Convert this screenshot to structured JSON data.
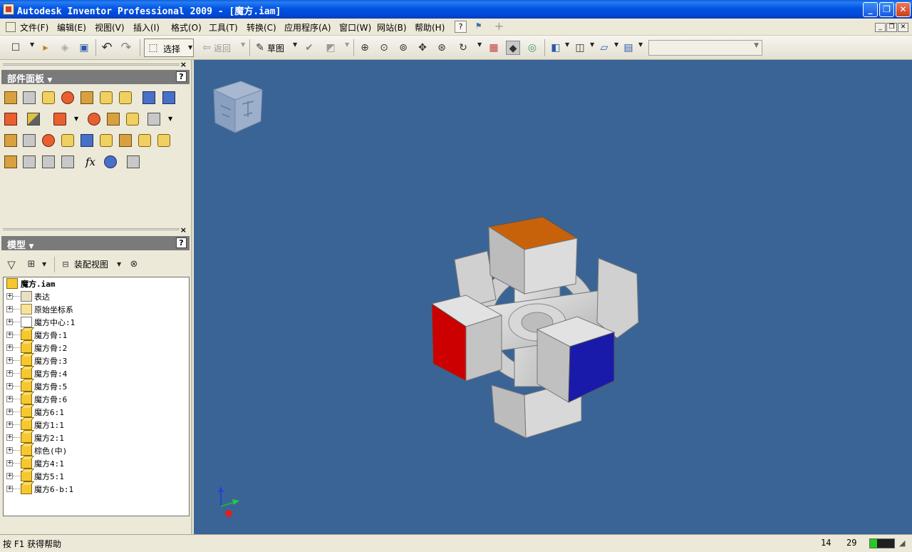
{
  "window": {
    "title": "Autodesk Inventor Professional 2009 - [魔方.iam]",
    "minimize": "_",
    "maximize": "❐",
    "close": "✕"
  },
  "menu": {
    "items": [
      "文件(F)",
      "编辑(E)",
      "视图(V)",
      "插入(I)",
      "格式(O)",
      "工具(T)",
      "转换(C)",
      "应用程序(A)",
      "窗口(W)",
      "网站(B)",
      "帮助(H)"
    ],
    "mdi_min": "_",
    "mdi_restore": "❐",
    "mdi_close": "✕"
  },
  "toolbar": {
    "select_label": "选择",
    "back_label": "返回",
    "sketch_label": "草图",
    "combo_value": ""
  },
  "panel": {
    "title": "部件面板",
    "help": "?",
    "close": "×"
  },
  "model": {
    "title": "模型",
    "help": "?",
    "close": "×",
    "view_label": "装配视图",
    "root": "魔方.iam",
    "items": [
      "表达",
      "原始坐标系",
      "魔方中心:1",
      "魔方骨:1",
      "魔方骨:2",
      "魔方骨:3",
      "魔方骨:4",
      "魔方骨:5",
      "魔方骨:6",
      "魔方6:1",
      "魔方1:1",
      "魔方2:1",
      "棕色(中)",
      "魔方4:1",
      "魔方5:1",
      "魔方6-b:1"
    ],
    "item_icons": [
      "rep-icon",
      "folder-icon",
      "center-part-icon",
      "part-icon",
      "part-icon",
      "part-icon",
      "part-icon",
      "part-icon",
      "part-icon",
      "part-icon",
      "part-icon",
      "part-icon",
      "part-icon",
      "part-icon",
      "part-icon",
      "part-icon"
    ]
  },
  "viewport": {
    "background": "#3a6496",
    "face_colors": {
      "top": "#c8620a",
      "left": "#cc0000",
      "right": "#1a1aaa"
    }
  },
  "status": {
    "help_text": "按 F1 获得帮助",
    "num1": "14",
    "num2": "29",
    "memory_level": 0.3
  }
}
